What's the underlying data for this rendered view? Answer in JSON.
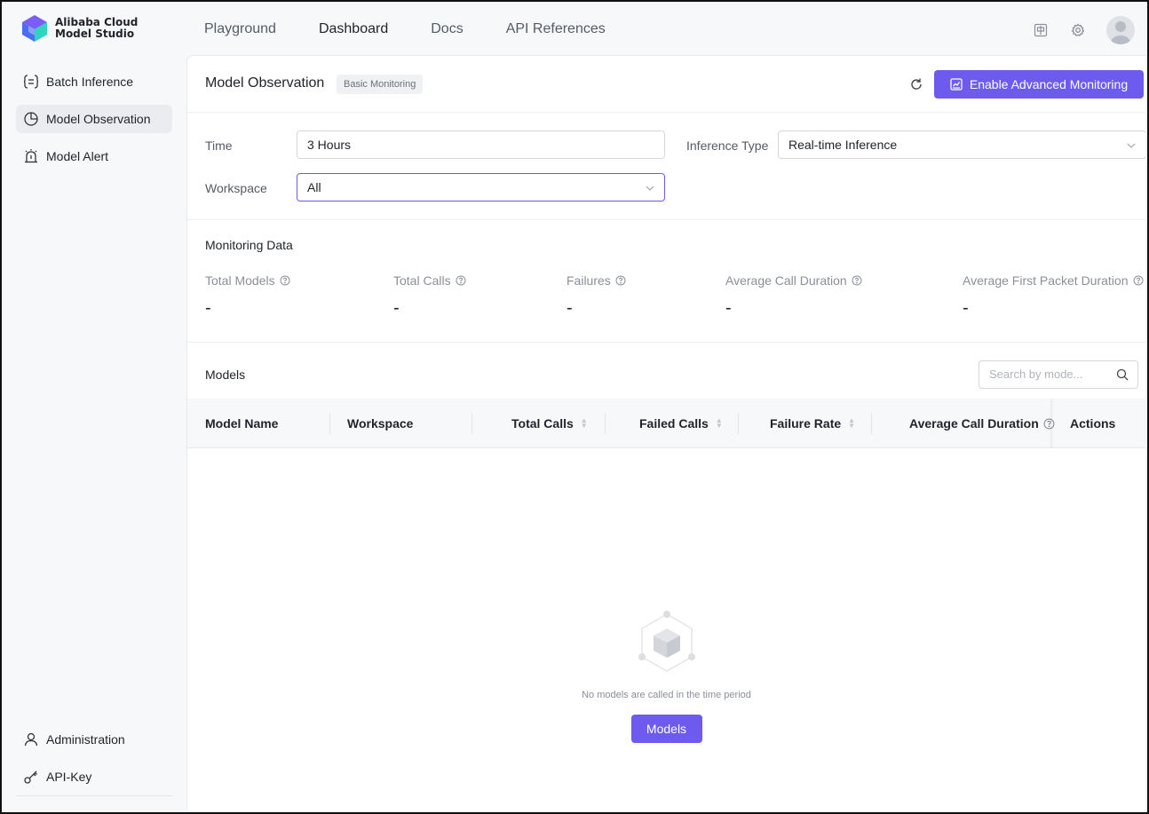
{
  "brand": {
    "line1": "Alibaba Cloud",
    "line2": "Model Studio"
  },
  "nav": [
    {
      "label": "Playground"
    },
    {
      "label": "Dashboard"
    },
    {
      "label": "Docs"
    },
    {
      "label": "API References"
    }
  ],
  "sidebar": {
    "items": [
      {
        "label": "Batch Inference",
        "icon": "batch-icon"
      },
      {
        "label": "Model Observation",
        "icon": "pie-chart-icon"
      },
      {
        "label": "Model Alert",
        "icon": "alarm-icon"
      }
    ],
    "bottom": [
      {
        "label": "Administration",
        "icon": "user-icon"
      },
      {
        "label": "API-Key",
        "icon": "key-icon"
      }
    ]
  },
  "header": {
    "title": "Model Observation",
    "badge": "Basic Monitoring",
    "enable_button": "Enable Advanced Monitoring"
  },
  "filters": {
    "time_label": "Time",
    "time_value": "3 Hours",
    "inference_label": "Inference Type",
    "inference_value": "Real-time Inference",
    "workspace_label": "Workspace",
    "workspace_value": "All"
  },
  "monitoring": {
    "title": "Monitoring Data",
    "metrics": [
      {
        "label": "Total Models",
        "value": "-"
      },
      {
        "label": "Total Calls",
        "value": "-"
      },
      {
        "label": "Failures",
        "value": "-"
      },
      {
        "label": "Average Call Duration",
        "value": "-"
      },
      {
        "label": "Average First Packet Duration",
        "value": "-"
      }
    ]
  },
  "models": {
    "title": "Models",
    "search_placeholder": "Search by mode...",
    "columns": [
      {
        "label": "Model Name"
      },
      {
        "label": "Workspace"
      },
      {
        "label": "Total Calls"
      },
      {
        "label": "Failed Calls"
      },
      {
        "label": "Failure Rate"
      },
      {
        "label": "Average Call Duration"
      },
      {
        "label": "Actions"
      }
    ],
    "empty_text": "No models are called in the time period",
    "empty_button": "Models"
  },
  "colors": {
    "primary": "#6d5bf0",
    "sidebar_bg": "#f7f8fa",
    "text": "#1f2329"
  }
}
